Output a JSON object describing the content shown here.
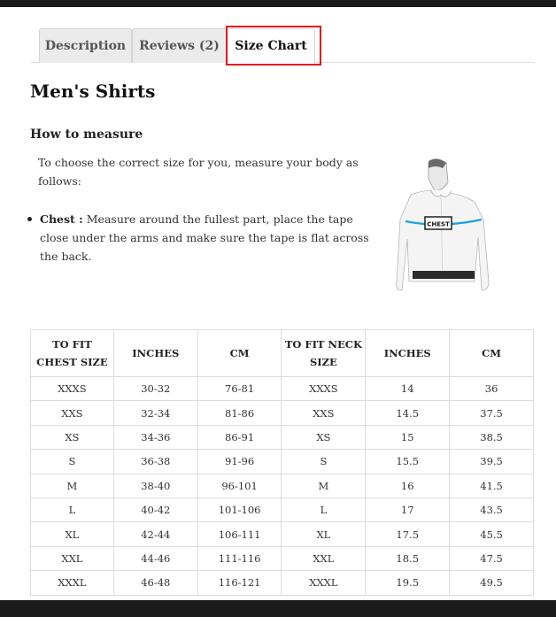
{
  "tabs": [
    {
      "label": "Description",
      "active": false
    },
    {
      "label": "Reviews (2)",
      "active": false
    },
    {
      "label": "Size Chart",
      "active": true
    }
  ],
  "highlight_color": "#e3131b",
  "content": {
    "title": "Men's Shirts",
    "subtitle": "How to measure",
    "intro": "To choose the correct size for you, measure your body as follows:",
    "bullets": [
      {
        "term": "Chest :",
        "text": " Measure around the fullest part, place the tape close under the arms and make sure the tape is flat across the back."
      }
    ],
    "figure_label": "CHEST"
  },
  "table": {
    "headers": [
      "TO FIT CHEST SIZE",
      "INCHES",
      "CM",
      "TO FIT NECK SIZE",
      "INCHES",
      "CM"
    ],
    "rows": [
      [
        "XXXS",
        "30-32",
        "76-81",
        "XXXS",
        "14",
        "36"
      ],
      [
        "XXS",
        "32-34",
        "81-86",
        "XXS",
        "14.5",
        "37.5"
      ],
      [
        "XS",
        "34-36",
        "86-91",
        "XS",
        "15",
        "38.5"
      ],
      [
        "S",
        "36-38",
        "91-96",
        "S",
        "15.5",
        "39.5"
      ],
      [
        "M",
        "38-40",
        "96-101",
        "M",
        "16",
        "41.5"
      ],
      [
        "L",
        "40-42",
        "101-106",
        "L",
        "17",
        "43.5"
      ],
      [
        "XL",
        "42-44",
        "106-111",
        "XL",
        "17.5",
        "45.5"
      ],
      [
        "XXL",
        "44-46",
        "111-116",
        "XXL",
        "18.5",
        "47.5"
      ],
      [
        "XXXL",
        "46-48",
        "116-121",
        "XXXL",
        "19.5",
        "49.5"
      ]
    ]
  }
}
